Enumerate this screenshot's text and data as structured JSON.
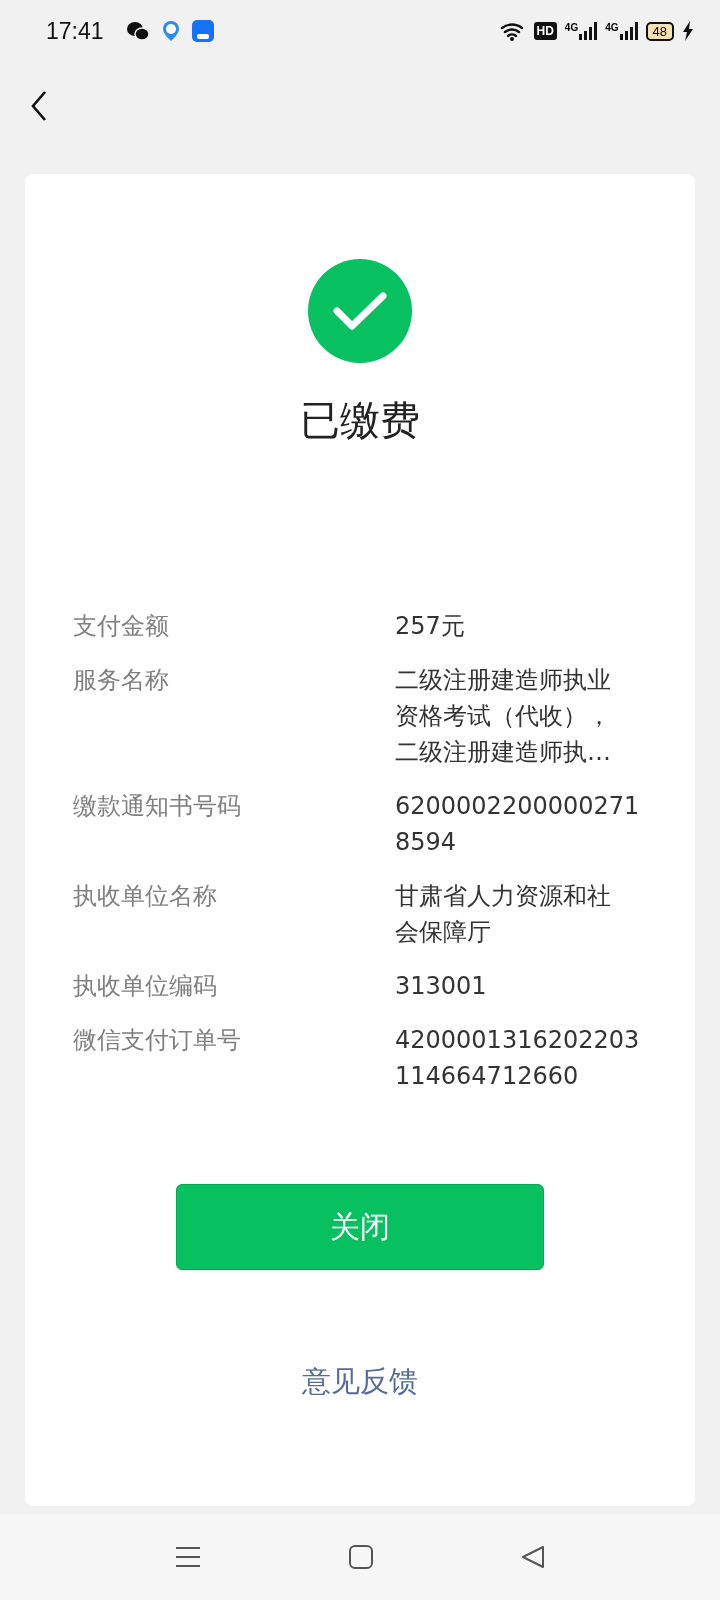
{
  "status_bar": {
    "time": "17:41",
    "hd_label": "HD",
    "network_labels": [
      "4G",
      "4G"
    ],
    "battery": "48"
  },
  "result": {
    "title": "已缴费"
  },
  "details": [
    {
      "label": "支付金额",
      "value": [
        "257元"
      ]
    },
    {
      "label": "服务名称",
      "value": [
        "二级注册建造师执业",
        "资格考试（代收），",
        "二级注册建造师执…"
      ]
    },
    {
      "label": "缴款通知书号码",
      "value": [
        "6200002200000271",
        "8594"
      ]
    },
    {
      "label": "执收单位名称",
      "value": [
        "甘肃省人力资源和社",
        "会保障厅"
      ]
    },
    {
      "label": "执收单位编码",
      "value": [
        "313001"
      ]
    },
    {
      "label": "微信支付订单号",
      "value": [
        "4200001316202203",
        "114664712660"
      ]
    }
  ],
  "close_button": "关闭",
  "feedback_link": "意见反馈"
}
